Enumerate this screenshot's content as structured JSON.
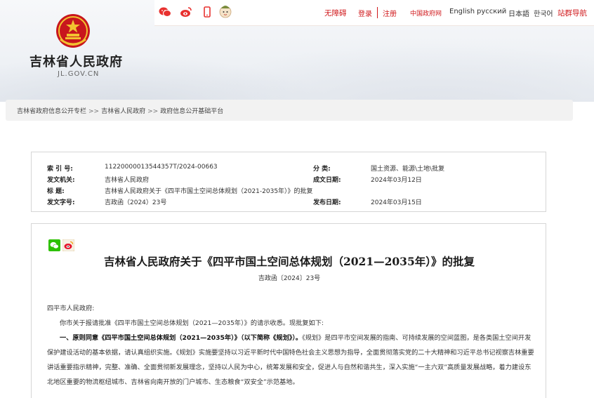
{
  "header": {
    "site_name": "吉林省人民政府",
    "site_domain": "JL.GOV.CN",
    "accessibility": "无障碍",
    "login": "登录",
    "register": "注册",
    "gov_cn": "中国政府网",
    "lang_en": "English",
    "lang_ru": "русский",
    "lang_jp": "日本語",
    "lang_kr": "한국어",
    "site_nav": "站群导航",
    "icons": [
      "wechat-icon",
      "weibo-icon",
      "mobile-icon",
      "mascot-icon"
    ]
  },
  "breadcrumb": {
    "items": [
      "吉林省政府信息公开专栏",
      "吉林省人民政府",
      "政府信息公开基础平台"
    ],
    "separator": ">>"
  },
  "meta": {
    "index_label": "索 引 号:",
    "index_value": "11220000013544357T/2024-00663",
    "category_label": "分     类:",
    "category_value": "国土资源、能源\\土地\\批复",
    "issuer_label": "发文机关:",
    "issuer_value": "吉林省人民政府",
    "created_label": "成文日期:",
    "created_value": "2024年03月12日",
    "title_label": "标     题:",
    "title_value": "吉林省人民政府关于《四平市国土空间总体规划（2021-2035年）》的批复",
    "docno_label": "发文字号:",
    "docno_value": "吉政函（2024）23号",
    "published_label": "发布日期:",
    "published_value": "2024年03月15日"
  },
  "document": {
    "title": "吉林省人民政府关于《四平市国土空间总体规划（2021—2035年）》的批复",
    "number": "吉政函〔2024〕23号",
    "salutation": "四平市人民政府:",
    "intro": "你市关于报请批准《四平市国土空间总体规划（2021—2035年）》的请示收悉。现批复如下:",
    "para1_bold": "一、原则同意《四平市国土空间总体规划（2021—2035年）》（以下简称《规划》）。",
    "para1_rest": "《规划》是四平市空间发展的指南、可持续发展的空间蓝图，是各类国土空间开发保护建设活动的基本依据，请认真组织实施。《规划》实施要坚持以习近平新时代中国特色社会主义思想为指导，全面贯彻落实党的二十大精神和习近平总书记视察吉林重要讲话重要指示精神，完整、准确、全面贯彻新发展理念，坚持以人民为中心，统筹发展和安全，促进人与自然和谐共生，深入实施“一主六双”高质量发展战略，着力建设东北地区重要的物流枢纽城市、吉林省向南开放的门户城市、生态粮食“双安全”示范基地。"
  },
  "colors": {
    "accent_red": "#d0191c",
    "wechat_green": "#2dc100",
    "weibo_orange": "#e6162d"
  }
}
